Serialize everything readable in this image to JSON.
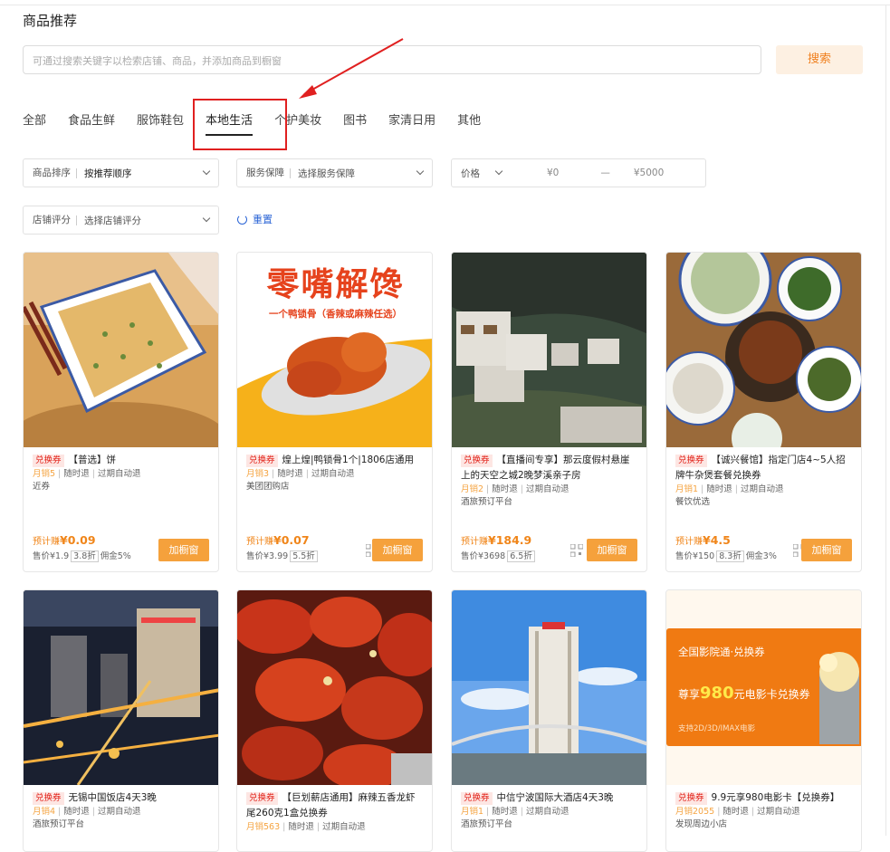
{
  "header": {
    "title": "商品推荐"
  },
  "search": {
    "placeholder": "可通过搜索关键字以检索店铺、商品，并添加商品到橱窗",
    "button_label": "搜索"
  },
  "tabs": [
    {
      "label": "全部",
      "active": false
    },
    {
      "label": "食品生鲜",
      "active": false
    },
    {
      "label": "服饰鞋包",
      "active": false
    },
    {
      "label": "本地生活",
      "active": true
    },
    {
      "label": "个护美妆",
      "active": false
    },
    {
      "label": "图书",
      "active": false
    },
    {
      "label": "家清日用",
      "active": false
    },
    {
      "label": "其他",
      "active": false
    }
  ],
  "filters": {
    "sort": {
      "label": "商品排序",
      "value": "按推荐顺序"
    },
    "service": {
      "label": "服务保障",
      "placeholder": "选择服务保障"
    },
    "price": {
      "label": "价格",
      "min": "¥0",
      "dash": "—",
      "max": "¥5000"
    },
    "rating": {
      "label": "店铺评分",
      "placeholder": "选择店铺评分"
    },
    "reset_label": "重置"
  },
  "products": [
    {
      "tag": "兑换券",
      "title": "【普选】饼",
      "sales": "月销5",
      "policy1": "随时退",
      "policy2": "过期自动退",
      "shop": "近券",
      "earn_label": "预计赚",
      "earn": "¥0.09",
      "price": "售价¥1.9",
      "discount": "3.8折",
      "commission": "佣金5%",
      "button": "加橱窗"
    },
    {
      "tag": "兑换券",
      "title": "煌上煌|鸭锁骨1个|1806店通用",
      "sales": "月销3",
      "policy1": "随时退",
      "policy2": "过期自动退",
      "shop": "美团团购店",
      "earn_label": "预计赚",
      "earn": "¥0.07",
      "price": "售价¥3.99",
      "discount": "5.5折",
      "commission": "",
      "button": "加橱窗"
    },
    {
      "tag": "兑换券",
      "title": "【直播间专享】那云度假村悬崖上的天空之城2晚梦溪亲子房",
      "sales": "月销2",
      "policy1": "随时退",
      "policy2": "过期自动退",
      "shop": "酒旅预订平台",
      "earn_label": "预计赚",
      "earn": "¥184.9",
      "price": "售价¥3698",
      "discount": "6.5折",
      "commission": "",
      "button": "加橱窗"
    },
    {
      "tag": "兑换券",
      "title": "【诚兴餐馆】指定门店4~5人招牌牛杂煲套餐兑换券",
      "sales": "月销1",
      "policy1": "随时退",
      "policy2": "过期自动退",
      "shop": "餐饮优选",
      "earn_label": "预计赚",
      "earn": "¥4.5",
      "price": "售价¥150",
      "discount": "8.3折",
      "commission": "佣金3%",
      "button": "加橱窗"
    },
    {
      "tag": "兑换券",
      "title": "无锡中国饭店4天3晚",
      "sales": "月销4",
      "policy1": "随时退",
      "policy2": "过期自动退",
      "shop": "酒旅预订平台"
    },
    {
      "tag": "兑换券",
      "title": "【巨划薪店通用】麻辣五香龙虾尾260克1盒兑换券",
      "sales": "月销563",
      "policy1": "随时退",
      "policy2": "过期自动退",
      "shop": ""
    },
    {
      "tag": "兑换券",
      "title": "中信宁波国际大酒店4天3晚",
      "sales": "月销1",
      "policy1": "随时退",
      "policy2": "过期自动退",
      "shop": "酒旅预订平台"
    },
    {
      "tag": "兑换券",
      "title": "9.9元享980电影卡【兑换券】",
      "sales": "月销2055",
      "policy1": "随时退",
      "policy2": "过期自动退",
      "shop": "发现周边小店"
    }
  ],
  "images": {
    "food2_line1": "零嘴解馋",
    "food2_line2": "一个鸭锁骨（香辣或麻辣任选）",
    "movie_line1": "全国影院通·兑换券",
    "movie_pre": "尊享",
    "movie_num": "980",
    "movie_post": "元电影卡兑换券",
    "movie_line3": "支持2D/3D/IMAX电影"
  },
  "colors": {
    "accent": "#f5a13c",
    "tag_red": "#e2231a",
    "annotation_red": "#e02020",
    "link_blue": "#2a64d6"
  }
}
